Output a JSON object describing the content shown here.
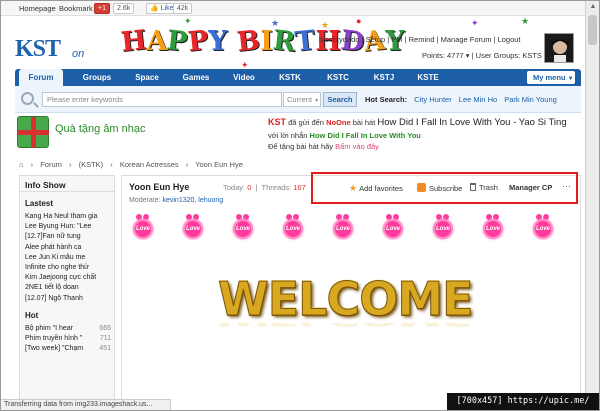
{
  "topbar": {
    "homepage": "Homepage",
    "bookmark": "Bookmark",
    "gplus_count": "+1",
    "gplus_label": "2.6k",
    "like_label": "Like",
    "like_count": "42k"
  },
  "header": {
    "logo": "KST",
    "logo_suffix": "on",
    "banner_letters": [
      "H",
      "A",
      "P",
      "P",
      "Y",
      " ",
      "B",
      "I",
      "R",
      "T",
      "H",
      "D",
      "A",
      "Y"
    ],
    "banner_colors": [
      "#e8262a",
      "#f6a01a",
      "#2e9c3c",
      "#e8262a",
      "#3a6fd8",
      "#ffffff",
      "#e8262a",
      "#f6a01a",
      "#2e9c3c",
      "#3a6fd8",
      "#e8262a",
      "#8a3fc8",
      "#f6a01a",
      "#2e9c3c"
    ]
  },
  "user": {
    "line1": "blochtydado  |  Setup  |  PM  |  Remind  |  Manage Forum  |  Logout",
    "line2": "Points: 4777  ▾   |   User Groups: KSTS"
  },
  "nav": {
    "items": [
      "Forum",
      "Groups",
      "Space",
      "Games",
      "Video",
      "KSTK",
      "KSTC",
      "KSTJ",
      "KSTE"
    ],
    "my_menu": "My menu"
  },
  "search": {
    "placeholder": "Please enter keywords",
    "scope": "Current",
    "button": "Search",
    "hot_label": "Hot Search:",
    "hot_items": [
      "City Hunter",
      "Lee Min Ho",
      "Park Min Young"
    ]
  },
  "banner": {
    "title": "Quà tặng âm nhạc",
    "kst": "KST",
    "line1_a": "đã gửi đến",
    "line1_user": "NoOne",
    "line1_b": "bài hát",
    "line1_song": "How Did I Fall In Love With You - Yao Si Ting",
    "line2_a": "với lời nhắn",
    "line2_msg": "How Did I Fall In Love With You",
    "line3_a": "Để tặng bài hát hãy",
    "line3_link": "Bấm vào đây"
  },
  "breadcrumb": [
    "⌂",
    "›",
    "Forum",
    "›",
    "(KSTK)",
    "›",
    "Korean Actresses",
    "›",
    "Yoon Eun Hye"
  ],
  "sidebar": {
    "title": "Info Show",
    "latest_label": "Lastest",
    "latest": [
      "Kang Ha Neul tham gia",
      "Lee Byung Hun: \"Lee",
      "[12.7]Fan nữ tung",
      "Alee phát hành ca",
      "Lee Jun Ki mẫu me",
      "Infinite cho nghe thử",
      "Kim Jaejoong cực chất",
      "2NE1 tiết lộ doan",
      "[12.07] Ngô Thanh"
    ],
    "hot_label": "Hot",
    "hot": [
      {
        "title": "Bộ phim \"I hear",
        "count": "665"
      },
      {
        "title": "Phim truyền hình \"",
        "count": "711"
      },
      {
        "title": "[Two week] \"Chạm",
        "count": "451"
      }
    ]
  },
  "forum": {
    "title": "Yoon Eun Hye",
    "today_label": "Today:",
    "today": "0",
    "threads_label": "Threads:",
    "threads": "167",
    "moderate_label": "Moderate:",
    "moderators": "kevin1320, lehuong",
    "actions": {
      "favorites": "Add favorites",
      "subscribe": "Subscribe",
      "trash": "Trash",
      "manager": "Manager CP",
      "more": "···"
    },
    "love_label": "Love",
    "welcome": "WELCOME"
  },
  "statusbar": "Transferring data from img233.imageshack.us...",
  "watermark": "[700x457] https://upic.me/"
}
